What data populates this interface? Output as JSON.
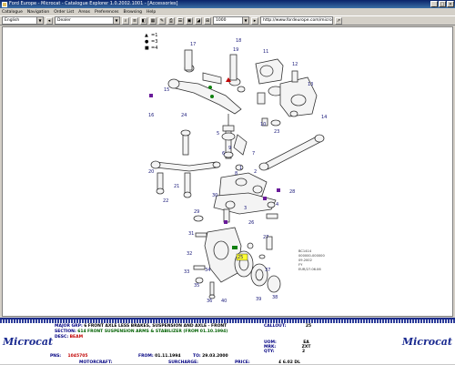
{
  "window": {
    "title": "Ford Europe - Microcat - Catalogue Explorer 1.0.2002.1001 - [Accessories]",
    "minimize": "_",
    "maximize": "□",
    "close": "×"
  },
  "menu": [
    "Catalogue",
    "Navigation",
    "Order List",
    "Areas",
    "Preferences",
    "Browsing",
    "Help"
  ],
  "toolbar": {
    "language": "English",
    "dealer": "Dealer",
    "code": "1000",
    "url": "http://www.fordeurope.com/microcat.net"
  },
  "legend": [
    {
      "symbol": "▲",
      "text": "=1",
      "color": "#c00000"
    },
    {
      "symbol": "●",
      "text": "=3",
      "color": "#108010"
    },
    {
      "symbol": "■",
      "text": "=4",
      "color": "#6a1b9a"
    }
  ],
  "diagram": {
    "ref_lines": [
      "BC1414",
      "000000-000000",
      "09.2002",
      "FY",
      "EUR/27.06.06"
    ],
    "callouts": [
      "17",
      "18",
      "19",
      "15",
      "16",
      "11",
      "12",
      "13",
      "14",
      "10",
      "23",
      "5",
      "6",
      "7",
      "8",
      "9",
      "24",
      "20",
      "21",
      "22",
      "25",
      "26",
      "27",
      "1",
      "2",
      "3",
      "4",
      "28",
      "29",
      "31",
      "30",
      "32",
      "33",
      "34",
      "35",
      "36",
      "37",
      "38",
      "39",
      "40"
    ]
  },
  "info": {
    "main_group_label": "MAJOR GRP:",
    "main_group_code": "6",
    "main_group_text": "FRONT AXLE LESS BRAKES, SUSPENSION AND AXLE - FRONT",
    "callout_label": "CALLOUT:",
    "callout_value": "25",
    "section_label": "SECTION:",
    "section_code": "614",
    "section_text": "FRONT SUSPENSION ARMS & STABILIZER (FROM 01.10.1994)",
    "desc_label": "DESC:",
    "desc_value": "BEAM",
    "qty_row_label": "QTY:",
    "qty_value": "2",
    "part_label": "PNS:",
    "part_value": "1045705",
    "from_label": "FROM:",
    "from_value": "01.11.1994",
    "to_label": "TO:",
    "to_value": "29.03.2000",
    "motorcraft_label": "MOTORCRAFT:",
    "surcharge_label": "SURCHARGE:",
    "price_label": "PRICE:",
    "price_value": "£ 6.02 DL",
    "uom_label": "UOM:",
    "uom_value": "EA",
    "mrk_label": "MRK:",
    "mrk_value": "ZXT"
  },
  "logo_left": "Microcat",
  "logo_right": "Microcat"
}
